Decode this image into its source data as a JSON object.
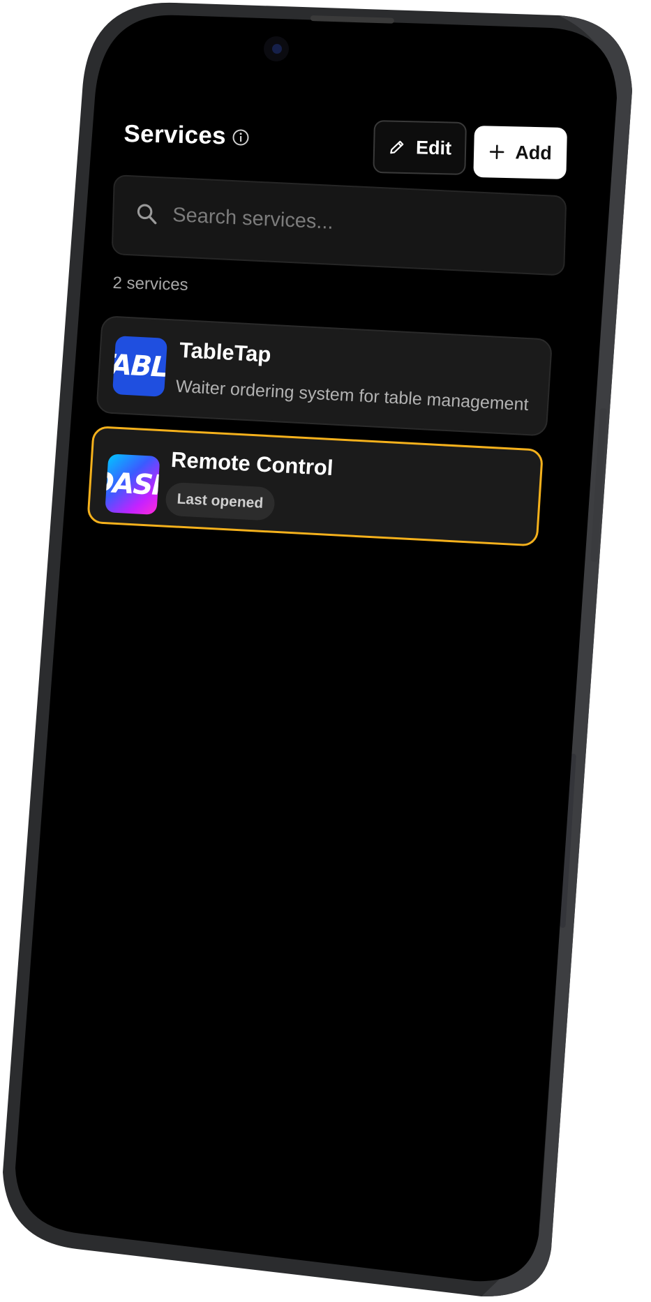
{
  "header": {
    "title": "Services",
    "info_icon": "info-icon",
    "edit_label": "Edit",
    "edit_icon": "pencil-icon",
    "add_label": "Add",
    "add_icon": "plus-icon"
  },
  "search": {
    "placeholder": "Search services...",
    "value": "",
    "icon": "search-icon"
  },
  "count_label": "2 services",
  "services": [
    {
      "name": "TableTap",
      "description": "Waiter ordering system for table management",
      "icon_text": "TABLE",
      "icon_color": "#1f4fe0"
    },
    {
      "name": "Remote Control",
      "badge": "Last opened",
      "icon_text": "DASH",
      "highlighted": true,
      "highlight_color": "#f5b11c"
    }
  ],
  "colors": {
    "screen_bg": "#000000",
    "card_bg": "#1b1b1b",
    "accent": "#f5b11c",
    "frame": "#2b2c2e"
  }
}
